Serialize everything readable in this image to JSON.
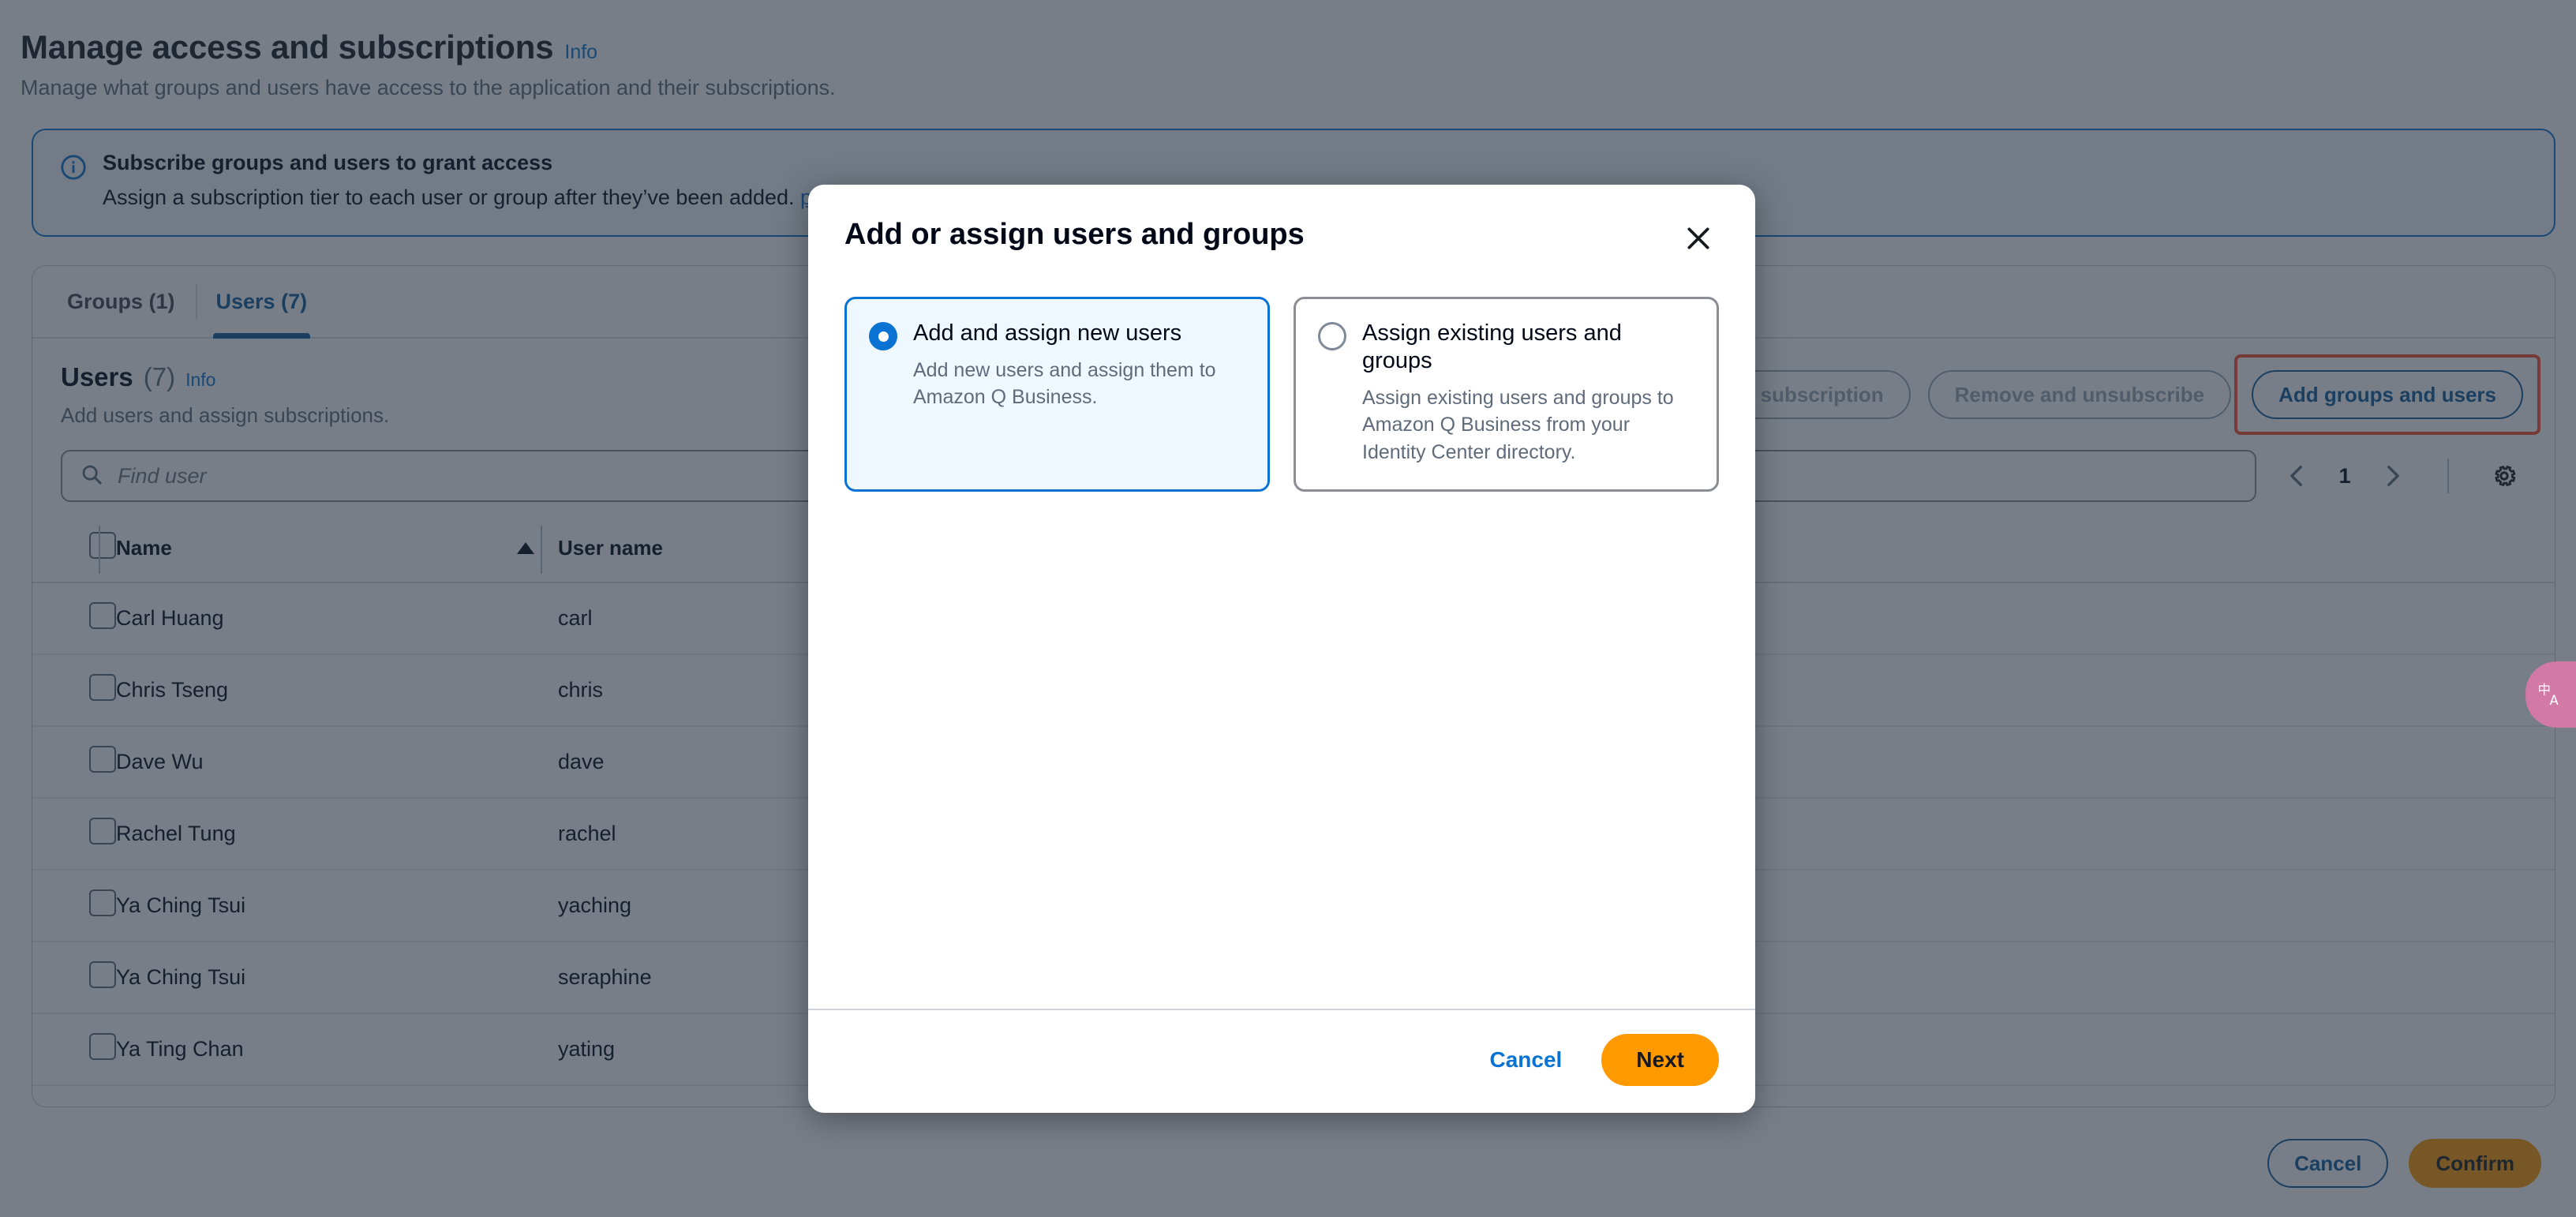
{
  "page": {
    "title": "Manage access and subscriptions",
    "info_label": "Info",
    "subtitle": "Manage what groups and users have access to the application and their subscriptions."
  },
  "alert": {
    "icon": "info-circle-icon",
    "heading": "Subscribe groups and users to grant access",
    "text": "Assign a subscription tier to each user or group after they’ve been added.",
    "link_text": "pricing document",
    "link_icon": "external-link-icon"
  },
  "tabs": [
    {
      "label": "Groups (1)",
      "active": false
    },
    {
      "label": "Users (7)",
      "active": true
    }
  ],
  "section": {
    "title": "Users",
    "count": "(7)",
    "info_label": "Info",
    "subtitle": "Add users and assign subscriptions.",
    "actions": [
      {
        "label": "Edit subscription",
        "state": "disabled"
      },
      {
        "label": "Remove and unsubscribe",
        "state": "disabled"
      },
      {
        "label": "Add groups and users",
        "state": "normal",
        "highlighted": true
      }
    ]
  },
  "search": {
    "placeholder": "Find user",
    "value": "",
    "icon": "search-icon"
  },
  "pagination": {
    "prev_icon": "chevron-left-icon",
    "page": "1",
    "next_icon": "chevron-right-icon",
    "settings_icon": "gear-icon"
  },
  "table": {
    "columns": [
      "Name",
      "User name"
    ],
    "sort_column": "Name",
    "sort_direction": "asc",
    "rows": [
      {
        "name": "Carl Huang",
        "username": "carl",
        "selected": false
      },
      {
        "name": "Chris Tseng",
        "username": "chris",
        "selected": false
      },
      {
        "name": "Dave Wu",
        "username": "dave",
        "selected": false
      },
      {
        "name": "Rachel Tung",
        "username": "rachel",
        "selected": false
      },
      {
        "name": "Ya Ching Tsui",
        "username": "yaching",
        "selected": false
      },
      {
        "name": "Ya Ching Tsui",
        "username": "seraphine",
        "selected": false
      },
      {
        "name": "Ya Ting Chan",
        "username": "yating",
        "selected": false
      }
    ]
  },
  "page_actions": {
    "cancel_label": "Cancel",
    "confirm_label": "Confirm"
  },
  "modal": {
    "title": "Add or assign users and groups",
    "close_icon": "close-icon",
    "options": [
      {
        "label": "Add and assign new users",
        "description": "Add new users and assign them to Amazon Q Business.",
        "selected": true
      },
      {
        "label": "Assign existing users and groups",
        "description": "Assign existing users and groups to Amazon Q Business from your Identity Center directory.",
        "selected": false
      }
    ],
    "cancel_label": "Cancel",
    "next_label": "Next"
  },
  "translate_widget": {
    "icon": "translate-icon"
  },
  "colors": {
    "accent_blue": "#0972d3",
    "tab_active": "#0f5a9c",
    "primary_orange": "#ff9900",
    "highlight_red": "#ff4d2d",
    "scrim": "rgba(35,47,62,0.62)",
    "widget_pink": "#d279a6"
  }
}
